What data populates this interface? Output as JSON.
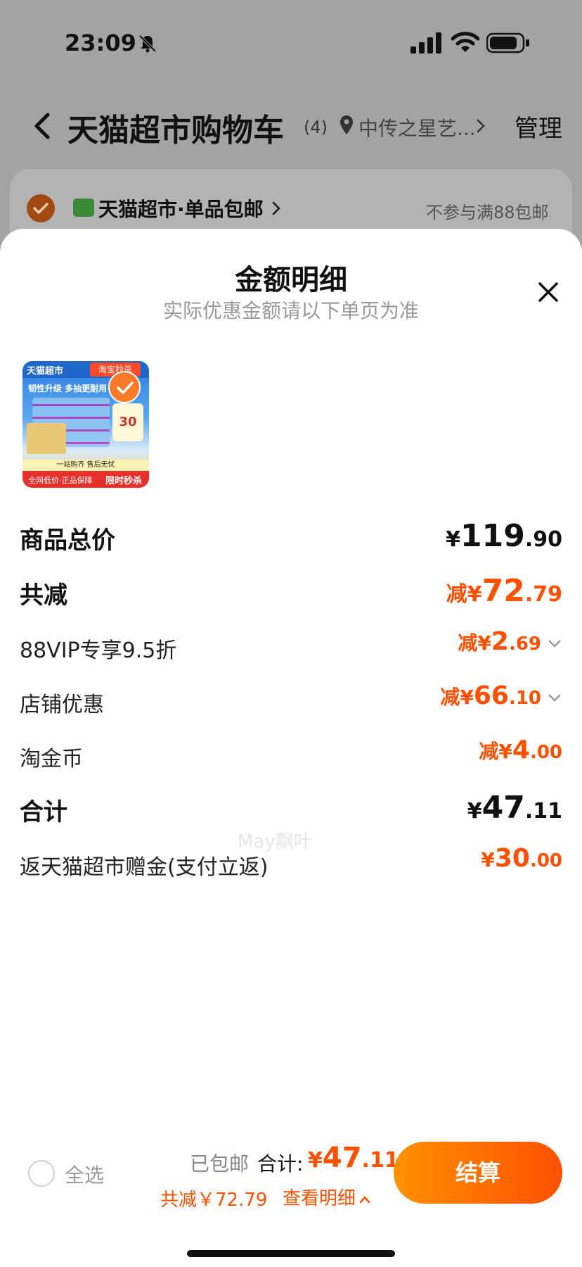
{
  "status_bar": {
    "time": "23:09"
  },
  "cart_header": {
    "title": "天猫超市购物车",
    "count": "(4)",
    "location": "中传之星艺...",
    "manage": "管理"
  },
  "store": {
    "name": "天猫超市·单品包邮",
    "note": "不参与满88包邮"
  },
  "sheet": {
    "title": "金额明细",
    "subtitle": "实际优惠金额请以下单页为准",
    "product_image": {
      "top_left": "天猫超市",
      "top_right": "淘宝秒杀",
      "headline": "韧性升级 多抽更耐用",
      "price_badge": "30",
      "strip": "一站购齐 售后无忧",
      "bottom_left": "全网低价·正品保障",
      "bottom_right": "限时秒杀"
    },
    "rows": [
      {
        "label": "商品总价",
        "prefix": "",
        "currency": "¥",
        "int": "119",
        "dec": ".90"
      },
      {
        "label": "共减",
        "prefix": "减",
        "currency": "¥",
        "int": "72",
        "dec": ".79"
      },
      {
        "label": "88VIP专享9.5折",
        "prefix": "减",
        "currency": "¥",
        "int": "2",
        "dec": ".69"
      },
      {
        "label": "店铺优惠",
        "prefix": "减",
        "currency": "¥",
        "int": "66",
        "dec": ".10"
      },
      {
        "label": "淘金币",
        "prefix": "减",
        "currency": "¥",
        "int": "4",
        "dec": ".00"
      },
      {
        "label": "合计",
        "prefix": "",
        "currency": "¥",
        "int": "47",
        "dec": ".11"
      },
      {
        "label": "返天猫超市赠金(支付立返)",
        "prefix": "",
        "currency": "¥",
        "int": "30",
        "dec": ".00"
      }
    ],
    "watermark": "May飘叶"
  },
  "footer": {
    "select_all": "全选",
    "shipping": "已包邮",
    "total_label": "合计:",
    "total_currency": "¥",
    "total_int": "47",
    "total_dec": ".11",
    "saved": "共减￥72.79",
    "details": "查看明细",
    "checkout": "结算"
  },
  "colors": {
    "accent": "#ff5000",
    "accent_light": "#ff9100"
  }
}
